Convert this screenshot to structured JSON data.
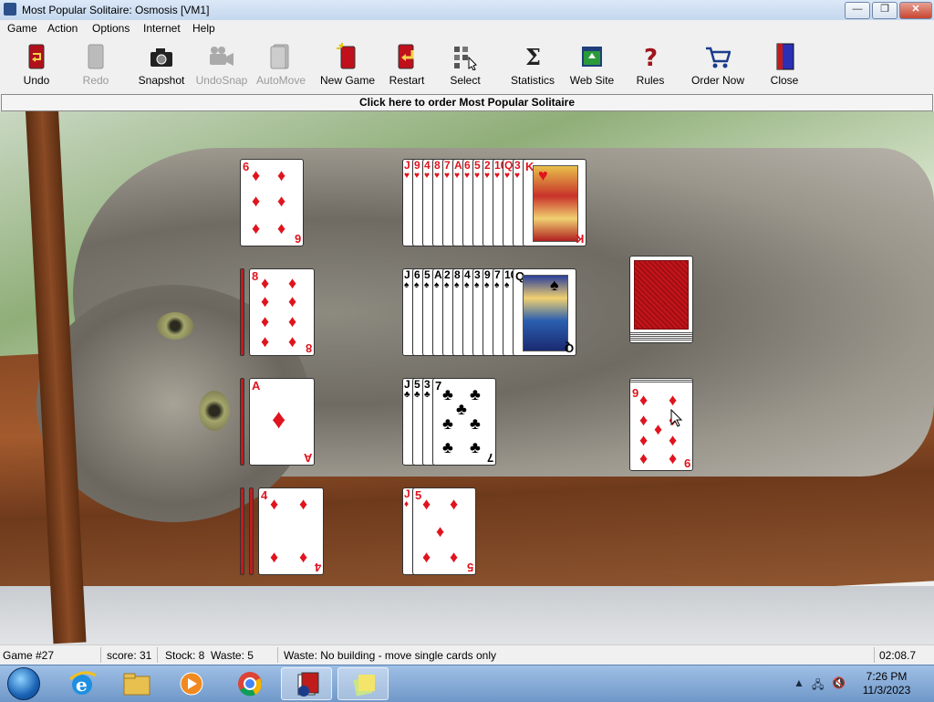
{
  "window": {
    "title": "Most Popular Solitaire: Osmosis [VM1]",
    "minimize_symbol": "—",
    "maximize_symbol": "❐",
    "close_symbol": "✕"
  },
  "menu": [
    "Game",
    "Action",
    "Options",
    "Internet",
    "Help"
  ],
  "toolbar": [
    {
      "label": "Undo",
      "icon": "undo-icon",
      "enabled": true
    },
    {
      "label": "Redo",
      "icon": "redo-icon",
      "enabled": false
    },
    {
      "label": "Snapshot",
      "icon": "camera-icon",
      "enabled": true
    },
    {
      "label": "UndoSnap",
      "icon": "video-camera-icon",
      "enabled": false
    },
    {
      "label": "AutoMove",
      "icon": "automove-icon",
      "enabled": false
    },
    {
      "label": "New Game",
      "icon": "new-game-icon",
      "enabled": true
    },
    {
      "label": "Restart",
      "icon": "restart-icon",
      "enabled": true
    },
    {
      "label": "Select",
      "icon": "select-icon",
      "enabled": true
    },
    {
      "label": "Statistics",
      "icon": "sigma-icon",
      "enabled": true
    },
    {
      "label": "Web Site",
      "icon": "website-icon",
      "enabled": true
    },
    {
      "label": "Rules",
      "icon": "question-icon",
      "enabled": true
    },
    {
      "label": "Order Now",
      "icon": "cart-icon",
      "enabled": true
    },
    {
      "label": "Close",
      "icon": "door-icon",
      "enabled": true
    }
  ],
  "banner": "Click here to order Most Popular Solitaire",
  "game": {
    "reserves": [
      {
        "top": {
          "rank": "6",
          "suit": "♦",
          "color": "red"
        },
        "hidden": 0
      },
      {
        "top": {
          "rank": "8",
          "suit": "♦",
          "color": "red"
        },
        "hidden": 1
      },
      {
        "top": {
          "rank": "A",
          "suit": "♦",
          "color": "red"
        },
        "hidden": 1
      },
      {
        "top": {
          "rank": "4",
          "suit": "♦",
          "color": "red"
        },
        "hidden": 2
      }
    ],
    "foundations": [
      {
        "strips": [
          {
            "rank": "J",
            "suit": "♥"
          },
          {
            "rank": "9",
            "suit": "♥"
          },
          {
            "rank": "4",
            "suit": "♥"
          },
          {
            "rank": "8",
            "suit": "♥"
          },
          {
            "rank": "7",
            "suit": "♥"
          },
          {
            "rank": "A",
            "suit": "♥"
          },
          {
            "rank": "6",
            "suit": "♥"
          },
          {
            "rank": "5",
            "suit": "♥"
          },
          {
            "rank": "2",
            "suit": "♥"
          },
          {
            "rank": "10",
            "suit": "♥"
          },
          {
            "rank": "Q",
            "suit": "♥"
          },
          {
            "rank": "3",
            "suit": "♥"
          }
        ],
        "top": {
          "rank": "K",
          "suit": "♥",
          "color": "red"
        }
      },
      {
        "strips": [
          {
            "rank": "J",
            "suit": "♠"
          },
          {
            "rank": "6",
            "suit": "♠"
          },
          {
            "rank": "5",
            "suit": "♠"
          },
          {
            "rank": "A",
            "suit": "♠"
          },
          {
            "rank": "2",
            "suit": "♠"
          },
          {
            "rank": "8",
            "suit": "♠"
          },
          {
            "rank": "4",
            "suit": "♠"
          },
          {
            "rank": "3",
            "suit": "♠"
          },
          {
            "rank": "9",
            "suit": "♠"
          },
          {
            "rank": "7",
            "suit": "♠"
          },
          {
            "rank": "10",
            "suit": "♠"
          }
        ],
        "top": {
          "rank": "Q",
          "suit": "♠",
          "color": "black"
        }
      },
      {
        "strips": [
          {
            "rank": "J",
            "suit": "♣"
          },
          {
            "rank": "5",
            "suit": "♣"
          },
          {
            "rank": "3",
            "suit": "♣"
          }
        ],
        "top": {
          "rank": "7",
          "suit": "♣",
          "color": "black"
        }
      },
      {
        "strips": [
          {
            "rank": "J",
            "suit": "♦"
          }
        ],
        "top": {
          "rank": "5",
          "suit": "♦",
          "color": "red"
        }
      }
    ],
    "waste_top": {
      "rank": "9",
      "suit": "♦",
      "color": "red"
    }
  },
  "status": {
    "game": "Game #27",
    "score": "score: 31",
    "stock_waste": "Stock: 8  Waste: 5",
    "message": "Waste: No building - move single cards only",
    "timer": "02:08.7"
  },
  "taskbar": {
    "apps": [
      "ie-icon",
      "explorer-folder-icon",
      "media-player-icon",
      "chrome-icon",
      "solitaire-app-icon",
      "sticky-notes-icon"
    ],
    "time": "7:26 PM",
    "date": "11/3/2023"
  }
}
